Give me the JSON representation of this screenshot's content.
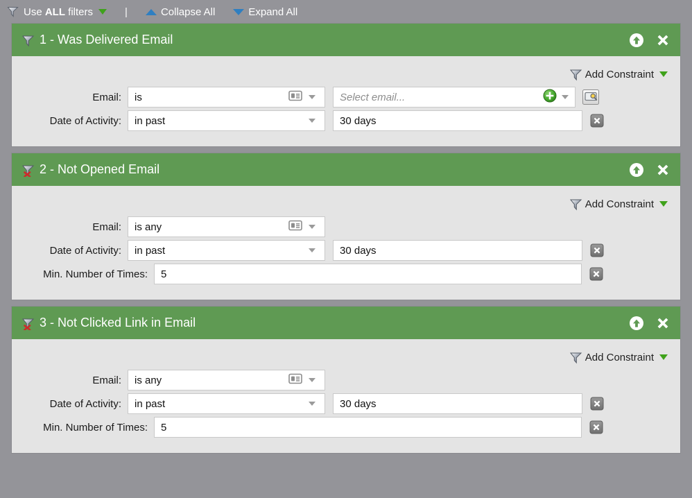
{
  "toolbar": {
    "use_all_prefix": "Use ",
    "use_all_bold": "ALL",
    "use_all_suffix": " filters",
    "divider": "|",
    "collapse_all": "Collapse All",
    "expand_all": "Expand All",
    "icons": {
      "funnel": "funnel-icon",
      "dropdown": "triangle-down-green-icon",
      "collapse": "triangle-up-blue-icon",
      "expand": "triangle-down-blue-icon"
    }
  },
  "colors": {
    "page_background": "#949499",
    "panel_header_green": "#5f9a53",
    "panel_body": "#e4e4e4",
    "accent_green": "#3fa21b",
    "accent_blue": "#2f7fc1",
    "spellcheck_red": "#e8453c"
  },
  "add_constraint_label": "Add Constraint",
  "panels": [
    {
      "title": "1 - Was Delivered Email",
      "negated": false,
      "rows": [
        {
          "label": "Email:",
          "label_width": 150,
          "operator": "is",
          "operator_width": 285,
          "has_idcard": true,
          "value_placeholder": "Select email...",
          "value_text": "",
          "value_width": 350,
          "has_plus": true,
          "has_search_button": true,
          "has_delete": false,
          "spellcheck_underline": true
        },
        {
          "label": "Date of Activity:",
          "label_width": 150,
          "operator": "in past",
          "operator_width": 285,
          "has_idcard": false,
          "value_text": "30 days",
          "value_width": 360,
          "has_plus": false,
          "has_search_button": false,
          "has_delete": true
        }
      ]
    },
    {
      "title": "2 - Not Opened Email",
      "negated": true,
      "rows": [
        {
          "label": "Email:",
          "label_width": 150,
          "operator": "is any",
          "operator_width": 285,
          "has_idcard": true,
          "value_text": null,
          "has_delete": false
        },
        {
          "label": "Date of Activity:",
          "label_width": 150,
          "operator": "in past",
          "operator_width": 285,
          "has_idcard": false,
          "value_text": "30 days",
          "value_width": 360,
          "has_delete": true
        },
        {
          "label": "Min. Number of Times:",
          "label_width": 188,
          "operator": null,
          "value_text": "5",
          "value_width": 617,
          "has_delete": true
        }
      ]
    },
    {
      "title": "3 - Not Clicked Link in Email",
      "negated": true,
      "rows": [
        {
          "label": "Email:",
          "label_width": 150,
          "operator": "is any",
          "operator_width": 285,
          "has_idcard": true,
          "value_text": null,
          "has_delete": false
        },
        {
          "label": "Date of Activity:",
          "label_width": 150,
          "operator": "in past",
          "operator_width": 285,
          "has_idcard": false,
          "value_text": "30 days",
          "value_width": 360,
          "has_delete": true
        },
        {
          "label": "Min. Number of Times:",
          "label_width": 188,
          "operator": null,
          "value_text": "5",
          "value_width": 617,
          "has_delete": true
        }
      ]
    }
  ],
  "panel_header_buttons": {
    "move_up": "move-up-icon",
    "remove": "remove-icon"
  }
}
